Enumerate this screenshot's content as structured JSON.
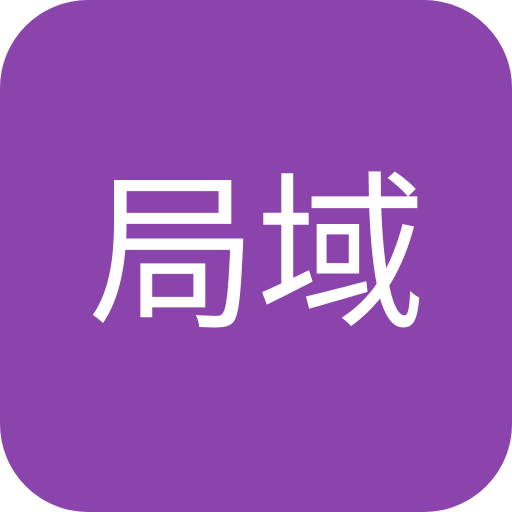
{
  "app_icon": {
    "label": "局域",
    "background_color": "#8B44AC",
    "text_color": "#FFFFFF"
  }
}
